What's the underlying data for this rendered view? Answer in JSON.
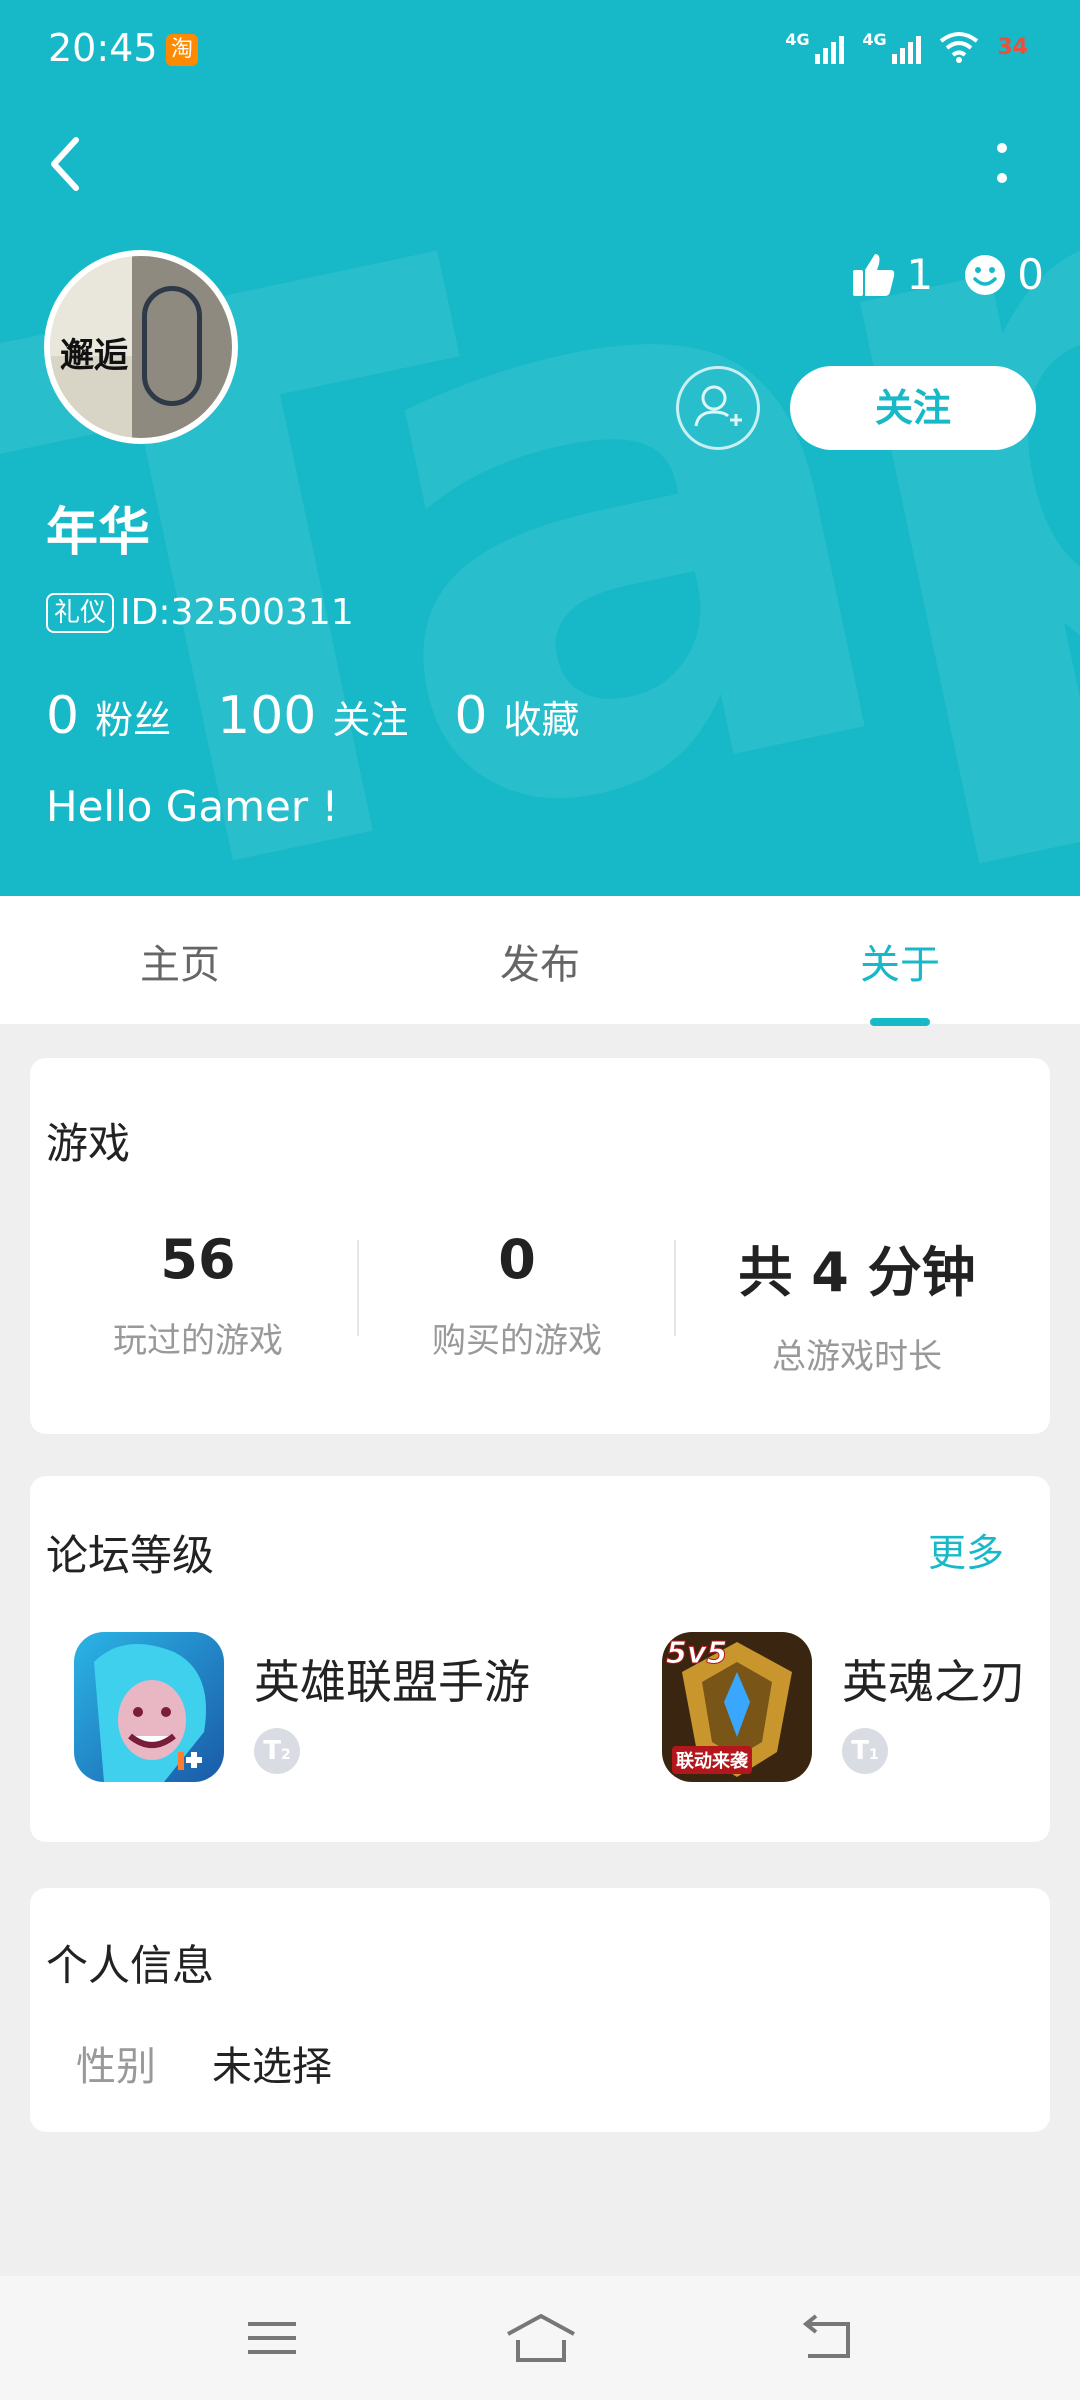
{
  "status_bar": {
    "time": "20:45",
    "taobao_icon_label": "淘",
    "network1": "4G",
    "network2": "4G",
    "battery": "34"
  },
  "header": {
    "likes": "1",
    "smiles": "0",
    "follow_label": "关注",
    "name": "年华",
    "badge": "礼仪",
    "id_text": "ID:32500311",
    "fans_count": "0",
    "fans_label": "粉丝",
    "following_count": "100",
    "following_label": "关注",
    "fav_count": "0",
    "fav_label": "收藏",
    "bio": "Hello Gamer !",
    "avatar_text": "邂逅",
    "accent": "#17b9c8"
  },
  "tabs": [
    {
      "label": "主页"
    },
    {
      "label": "发布"
    },
    {
      "label": "关于"
    }
  ],
  "games_card": {
    "title": "游戏",
    "stats": [
      {
        "value": "56",
        "label": "玩过的游戏"
      },
      {
        "value": "0",
        "label": "购买的游戏"
      },
      {
        "value": "共 4 分钟",
        "label": "总游戏时长"
      }
    ]
  },
  "forum_card": {
    "title": "论坛等级",
    "more": "更多",
    "items": [
      {
        "name": "英雄联盟手游",
        "rank": "T",
        "rank_level": "2"
      },
      {
        "name": "英魂之刃",
        "rank": "T",
        "rank_level": "1",
        "icon_text": "5v5",
        "icon_sub": "联动来袭"
      }
    ]
  },
  "info_card": {
    "title": "个人信息",
    "gender_label": "性别",
    "gender_value": "未选择"
  }
}
